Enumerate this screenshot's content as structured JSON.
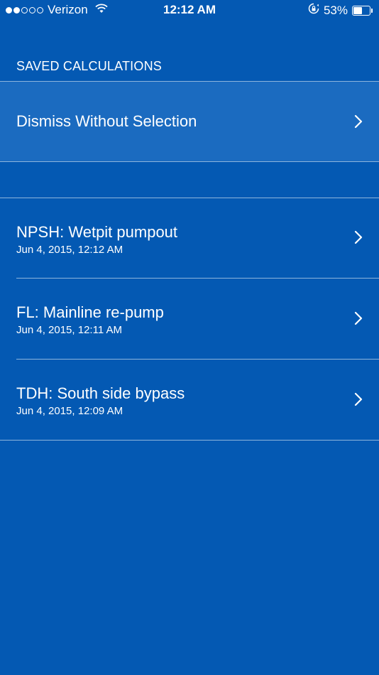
{
  "status_bar": {
    "carrier": "Verizon",
    "signal_bars_filled": 2,
    "signal_bars_total": 5,
    "time": "12:12 AM",
    "battery_percent": "53%",
    "battery_level": 0.53,
    "icons": [
      "wifi-icon",
      "rotation-lock-icon",
      "battery-icon"
    ]
  },
  "section_header": "SAVED CALCULATIONS",
  "dismiss": {
    "label": "Dismiss Without Selection"
  },
  "calculations": [
    {
      "title": "NPSH: Wetpit pumpout",
      "date": "Jun 4, 2015, 12:12 AM"
    },
    {
      "title": "FL: Mainline re-pump",
      "date": "Jun 4, 2015, 12:11 AM"
    },
    {
      "title": "TDH: South side bypass",
      "date": "Jun 4, 2015, 12:09 AM"
    }
  ],
  "colors": {
    "background": "#0459B3",
    "highlight_row": "#1B6BC0",
    "text": "#FFFFFF"
  }
}
